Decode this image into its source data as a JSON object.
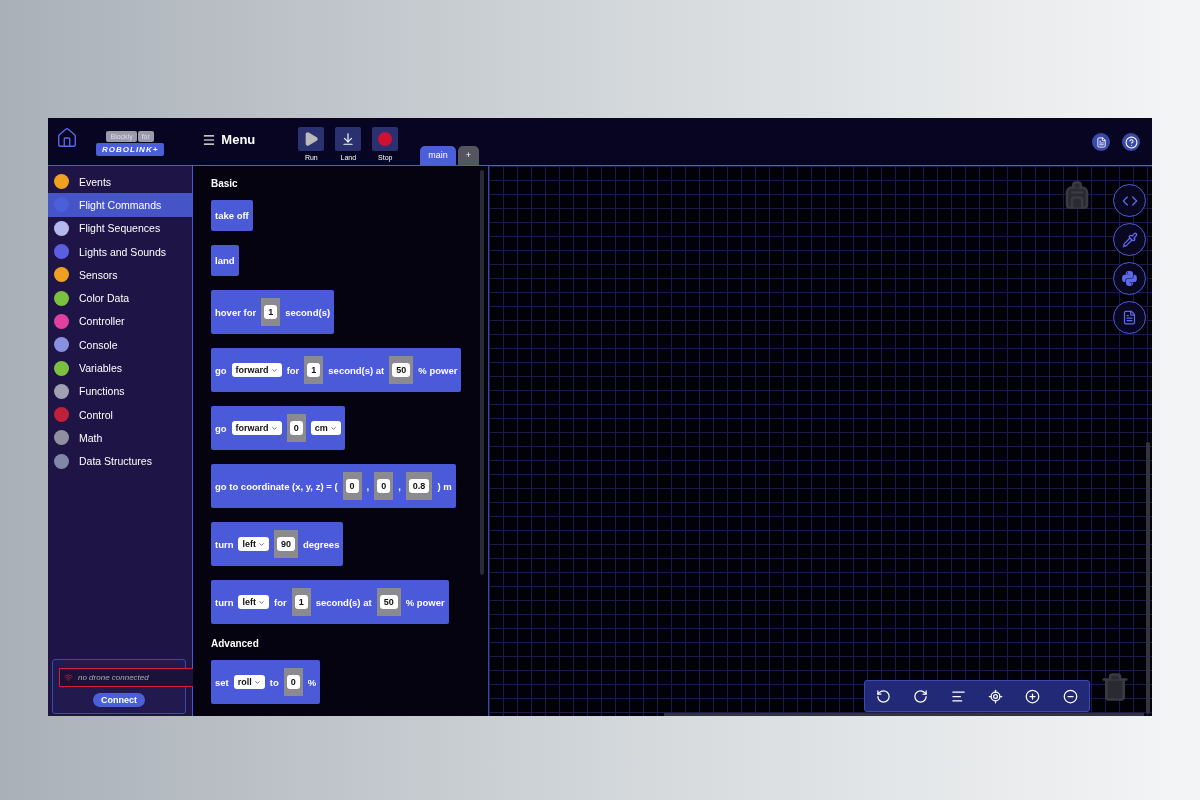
{
  "header": {
    "logo": {
      "badge": "Blockly",
      "badge_suffix": "for",
      "brand": "ROBOLINK+"
    },
    "menu": "Menu",
    "tools": [
      {
        "label": "Run",
        "kind": "play"
      },
      {
        "label": "Land",
        "kind": "land"
      },
      {
        "label": "Stop",
        "kind": "stop"
      }
    ],
    "tabs": [
      {
        "label": "main",
        "selected": true
      }
    ],
    "add_tab": "+"
  },
  "sidebar": {
    "items": [
      {
        "label": "Events",
        "color": "#f0a020",
        "selected": false
      },
      {
        "label": "Flight Commands",
        "color": "#4a5fd8",
        "selected": true
      },
      {
        "label": "Flight Sequences",
        "color": "#b4b8ec",
        "selected": false
      },
      {
        "label": "Lights and Sounds",
        "color": "#5a5ee0",
        "selected": false
      },
      {
        "label": "Sensors",
        "color": "#f0a020",
        "selected": false
      },
      {
        "label": "Color Data",
        "color": "#7cc040",
        "selected": false
      },
      {
        "label": "Controller",
        "color": "#e040a0",
        "selected": false
      },
      {
        "label": "Console",
        "color": "#8890e0",
        "selected": false
      },
      {
        "label": "Variables",
        "color": "#7cc040",
        "selected": false
      },
      {
        "label": "Functions",
        "color": "#a0a0b0",
        "selected": false
      },
      {
        "label": "Control",
        "color": "#c0203a",
        "selected": false
      },
      {
        "label": "Math",
        "color": "#9090a0",
        "selected": false
      },
      {
        "label": "Data Structures",
        "color": "#8088a8",
        "selected": false
      }
    ],
    "connection": {
      "placeholder": "no drone connected",
      "button": "Connect"
    }
  },
  "flyout": {
    "sections": [
      {
        "title": "Basic",
        "blocks": [
          {
            "parts": [
              {
                "kind": "text",
                "text": "take off"
              }
            ]
          },
          {
            "parts": [
              {
                "kind": "text",
                "text": "land"
              }
            ]
          },
          {
            "parts": [
              {
                "kind": "text",
                "text": "hover for"
              },
              {
                "kind": "number",
                "text": "1"
              },
              {
                "kind": "text",
                "text": "second(s)"
              }
            ]
          },
          {
            "parts": [
              {
                "kind": "text",
                "text": "go"
              },
              {
                "kind": "dropdown",
                "text": "forward"
              },
              {
                "kind": "text",
                "text": "for"
              },
              {
                "kind": "number",
                "text": "1"
              },
              {
                "kind": "text",
                "text": "second(s) at"
              },
              {
                "kind": "number",
                "text": "50"
              },
              {
                "kind": "text",
                "text": "% power"
              }
            ]
          },
          {
            "parts": [
              {
                "kind": "text",
                "text": "go"
              },
              {
                "kind": "dropdown",
                "text": "forward"
              },
              {
                "kind": "number",
                "text": "0"
              },
              {
                "kind": "dropdown",
                "text": "cm"
              }
            ]
          },
          {
            "parts": [
              {
                "kind": "text",
                "text": "go to coordinate (x, y, z) = ("
              },
              {
                "kind": "number",
                "text": "0"
              },
              {
                "kind": "text",
                "text": ","
              },
              {
                "kind": "number",
                "text": "0"
              },
              {
                "kind": "text",
                "text": ","
              },
              {
                "kind": "number",
                "text": "0.8"
              },
              {
                "kind": "text",
                "text": ") m"
              }
            ]
          },
          {
            "parts": [
              {
                "kind": "text",
                "text": "turn"
              },
              {
                "kind": "dropdown",
                "text": "left"
              },
              {
                "kind": "number",
                "text": "90"
              },
              {
                "kind": "text",
                "text": "degrees"
              }
            ]
          },
          {
            "parts": [
              {
                "kind": "text",
                "text": "turn"
              },
              {
                "kind": "dropdown",
                "text": "left"
              },
              {
                "kind": "text",
                "text": "for"
              },
              {
                "kind": "number",
                "text": "1"
              },
              {
                "kind": "text",
                "text": "second(s) at"
              },
              {
                "kind": "number",
                "text": "50"
              },
              {
                "kind": "text",
                "text": "% power"
              }
            ]
          }
        ]
      },
      {
        "title": "Advanced",
        "blocks": [
          {
            "parts": [
              {
                "kind": "text",
                "text": "set"
              },
              {
                "kind": "dropdown",
                "text": "roll"
              },
              {
                "kind": "text",
                "text": "to"
              },
              {
                "kind": "number",
                "text": "0"
              },
              {
                "kind": "text",
                "text": "%"
              }
            ]
          }
        ]
      }
    ]
  }
}
